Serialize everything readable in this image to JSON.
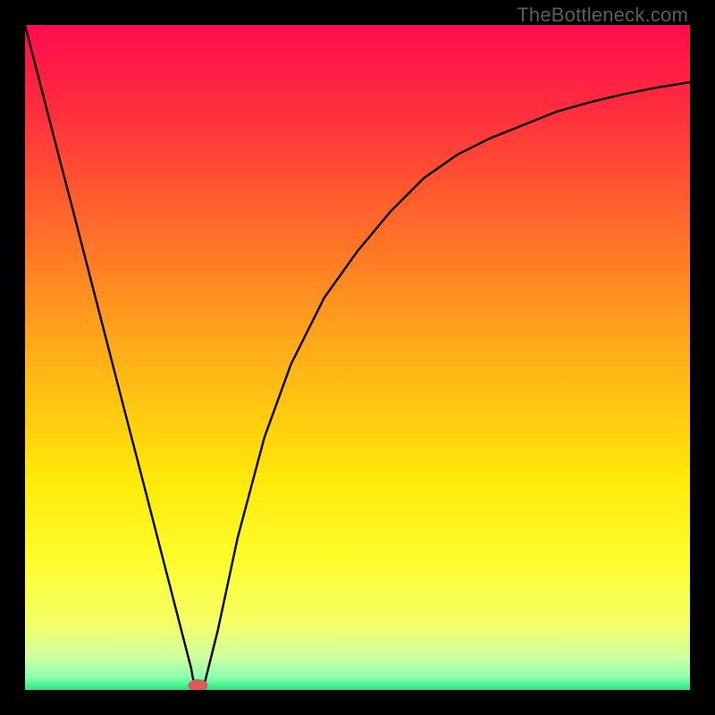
{
  "watermark": "TheBottleneck.com",
  "chart_data": {
    "type": "line",
    "title": "",
    "xlabel": "",
    "ylabel": "",
    "xlim": [
      0,
      1
    ],
    "ylim": [
      0,
      1
    ],
    "x": [
      0.0,
      0.025,
      0.05,
      0.075,
      0.1,
      0.125,
      0.15,
      0.175,
      0.2,
      0.225,
      0.25,
      0.252,
      0.255,
      0.26,
      0.27,
      0.29,
      0.32,
      0.36,
      0.4,
      0.45,
      0.5,
      0.55,
      0.6,
      0.65,
      0.7,
      0.75,
      0.8,
      0.85,
      0.9,
      0.95,
      1.0
    ],
    "values": [
      1.0,
      0.903,
      0.806,
      0.71,
      0.613,
      0.516,
      0.419,
      0.323,
      0.226,
      0.129,
      0.032,
      0.02,
      0.008,
      0.0,
      0.01,
      0.09,
      0.23,
      0.38,
      0.49,
      0.59,
      0.66,
      0.72,
      0.77,
      0.805,
      0.83,
      0.85,
      0.87,
      0.884,
      0.896,
      0.906,
      0.914
    ],
    "minimum_marker": {
      "x": 0.26,
      "y": 0.0,
      "shape": "ellipse",
      "color": "#d85a5a"
    },
    "background_gradient_stops": [
      {
        "offset": 0.0,
        "color": "#ff0c4c"
      },
      {
        "offset": 0.12,
        "color": "#ff2b3e"
      },
      {
        "offset": 0.3,
        "color": "#ff6a2a"
      },
      {
        "offset": 0.5,
        "color": "#ffb017"
      },
      {
        "offset": 0.68,
        "color": "#ffe80a"
      },
      {
        "offset": 0.8,
        "color": "#fffc2b"
      },
      {
        "offset": 0.9,
        "color": "#f4ff66"
      },
      {
        "offset": 0.95,
        "color": "#cfffa0"
      },
      {
        "offset": 0.98,
        "color": "#8fffb0"
      },
      {
        "offset": 1.0,
        "color": "#25e87e"
      }
    ]
  }
}
